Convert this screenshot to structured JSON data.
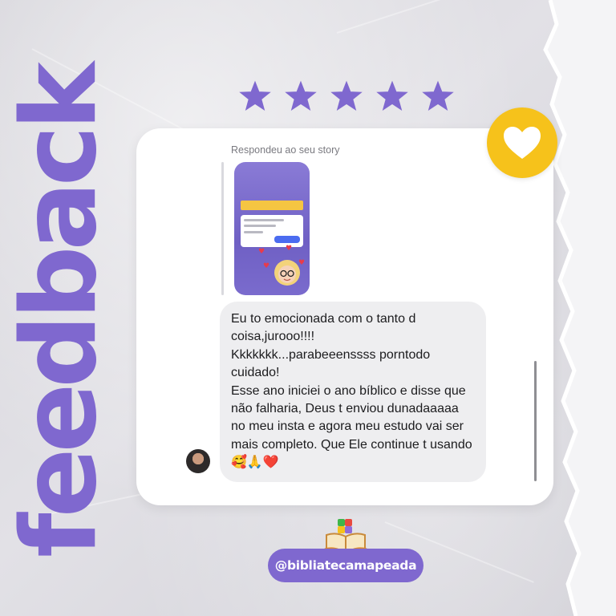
{
  "decor_word": "feedback",
  "rating": {
    "stars": 5,
    "max": 5,
    "star_icon": "star-icon"
  },
  "card": {
    "reply_caption": "Respondeu ao seu story",
    "message_lines": [
      "Eu to emocionada com o tanto d coisa,jurooo!!!!",
      "Kkkkkkk...parabeeenssss porntodo cuidado!",
      "Esse ano iniciei o ano bíblico e disse que não falharia, Deus t enviou dunadaaaaa no meu insta e agora meu estudo vai ser mais completo. Que Ele continue t usando🥰🙏❤️"
    ]
  },
  "badge": {
    "icon": "heart-icon"
  },
  "footer": {
    "book_icon": "book-icon",
    "handle": "@bibliatecamapeada"
  },
  "colors": {
    "accent_purple": "#7f68cf",
    "badge_yellow": "#f6c21b",
    "card_white": "#ffffff",
    "bubble_gray": "#eeeef0",
    "background": "#dcdbe0"
  }
}
